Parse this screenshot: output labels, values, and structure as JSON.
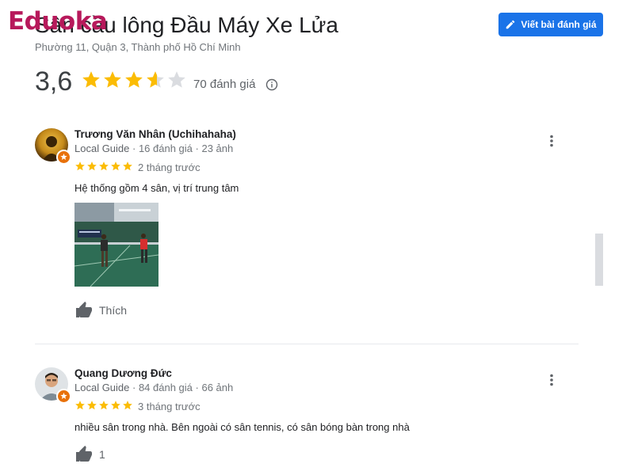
{
  "watermark": {
    "text": "Eduoka"
  },
  "place": {
    "title": "Sân cầu lông Đầu Máy Xe Lửa",
    "address": "Phường 11, Quận 3, Thành phố Hồ Chí Minh",
    "rating": "3,6",
    "rating_value": 3.6,
    "review_count": "70 đánh giá"
  },
  "actions": {
    "write_review_label": "Viết bài đánh giá",
    "write_review_icon": "pencil-icon",
    "info_icon": "info-icon"
  },
  "colors": {
    "accent": "#1a73e8",
    "star": "#fbbc04",
    "star_empty": "#dadce0",
    "badge": "#e8710a",
    "watermark": "#b7195b"
  },
  "reviews": [
    {
      "author": "Trương Văn Nhân (Uchihahaha)",
      "guide": "Local Guide",
      "review_count": "16 đánh giá",
      "photo_count": "23 ảnh",
      "stars": 5,
      "time": "2 tháng trước",
      "text": "Hệ thống gồm 4 sân, vị trí trung tâm",
      "has_photo": true,
      "like_label": "Thích"
    },
    {
      "author": "Quang Dương Đức",
      "guide": "Local Guide",
      "review_count": "84 đánh giá",
      "photo_count": "66 ảnh",
      "stars": 5,
      "time": "3 tháng trước",
      "text": "nhiều sân trong nhà. Bên ngoài có sân tennis, có sân bóng bàn trong nhà",
      "has_photo": false,
      "like_label": "1"
    }
  ]
}
